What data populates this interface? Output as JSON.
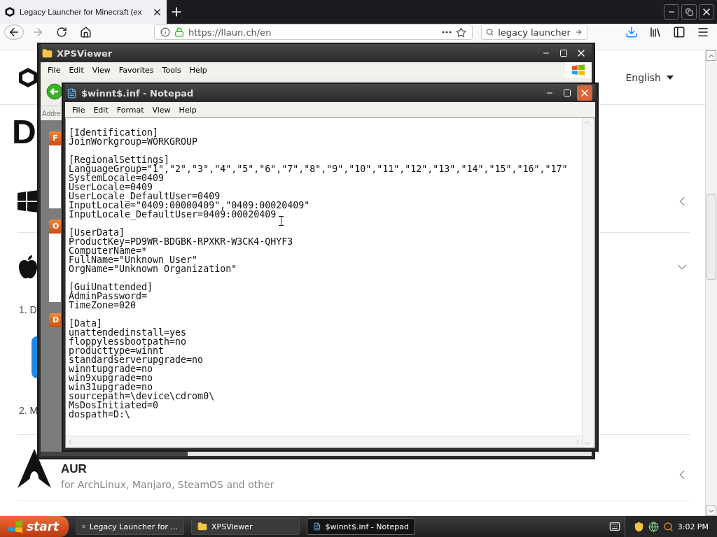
{
  "browser": {
    "tab": {
      "title": "Legacy Launcher for Minecraft (ex",
      "selected": true
    },
    "address": "https://llaun.ch/en",
    "search": "legacy launcher"
  },
  "page": {
    "language": "English",
    "heading": "D",
    "rows": [
      {
        "kind": "windows",
        "expanded": false
      },
      {
        "kind": "apple",
        "expanded": true,
        "steps": [
          "1. D",
          "2. M"
        ]
      },
      {
        "kind": "arch",
        "expanded": false,
        "title": "AUR",
        "subtitle": "for ArchLinux, Manjaro, SteamOS and other"
      }
    ]
  },
  "xps_viewer": {
    "title": "XPSViewer",
    "menu": [
      "File",
      "Edit",
      "View",
      "Favorites",
      "Tools",
      "Help"
    ],
    "address_label": "Addre",
    "panels": [
      "F",
      "O",
      "D"
    ]
  },
  "notepad": {
    "title": "$winnt$.inf - Notepad",
    "menu": [
      "File",
      "Edit",
      "Format",
      "View",
      "Help"
    ],
    "sections": [
      {
        "header": "[Identification]",
        "lines": [
          "JoinWorkgroup=WORKGROUP"
        ]
      },
      {
        "header": "[RegionalSettings]",
        "lines": [
          "LanguageGroup=\"1\",\"2\",\"3\",\"4\",\"5\",\"6\",\"7\",\"8\",\"9\",\"10\",\"11\",\"12\",\"13\",\"14\",\"15\",\"16\",\"17\"",
          "SystemLocale=0409",
          "UserLocale=0409",
          "UserLocale_DefaultUser=0409",
          "InputLocale=\"0409:00000409\",\"0409:00020409\"",
          "InputLocale_DefaultUser=0409:00020409"
        ]
      },
      {
        "header": "[UserData]",
        "lines": [
          "ProductKey=PD9WR-BDGBK-RPXKR-W3CK4-QHYF3",
          "ComputerName=*",
          "FullName=\"Unknown User\"",
          "OrgName=\"Unknown Organization\""
        ]
      },
      {
        "header": "[GuiUnattended]",
        "lines": [
          "AdminPassword=",
          "TimeZone=020"
        ]
      },
      {
        "header": "[Data]",
        "lines": [
          "unattendedinstall=yes",
          "floppylessbootpath=no",
          "producttype=winnt",
          "standardserverupgrade=no",
          "winntupgrade=no",
          "win9xupgrade=no",
          "win31upgrade=no",
          "sourcepath=\\device\\cdrom0\\",
          "MsDosInitiated=0",
          "dospath=D:\\"
        ]
      }
    ]
  },
  "taskbar": {
    "start": "start",
    "tasks": [
      {
        "kind": "browser",
        "label": "Legacy Launcher for ...",
        "selected": false
      },
      {
        "kind": "folder",
        "label": "XPSViewer",
        "selected": false
      },
      {
        "kind": "notepad",
        "label": "$winnt$.inf - Notepad",
        "selected": true
      }
    ],
    "clock": "3:02 PM"
  }
}
